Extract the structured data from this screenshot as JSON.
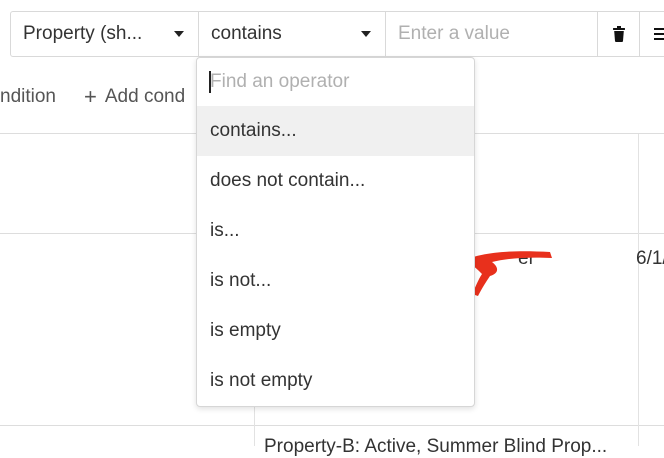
{
  "filter": {
    "property_label": "Property (sh...",
    "operator_label": "contains",
    "value": "",
    "value_placeholder": "Enter a value",
    "delete_icon": "trash-icon",
    "more_icon": "more-options-icon"
  },
  "actions": {
    "condition_fragment": "ndition",
    "add_condition_label": "Add cond"
  },
  "background": {
    "cell_fragment_1": "Property-B: Active, Summer Blind Prop...",
    "date_fragment": "6/1/",
    "redacted_fragment": "er"
  },
  "operator_dropdown": {
    "search_placeholder": "Find an operator",
    "search_value": "",
    "highlighted_index": 0,
    "options": [
      {
        "label": "contains..."
      },
      {
        "label": "does not contain..."
      },
      {
        "label": "is..."
      },
      {
        "label": "is not..."
      },
      {
        "label": "is empty"
      },
      {
        "label": "is not empty"
      }
    ]
  },
  "colors": {
    "redaction": "#e8301c",
    "highlight": "#f0f0f0",
    "border": "#d9d9d9"
  }
}
